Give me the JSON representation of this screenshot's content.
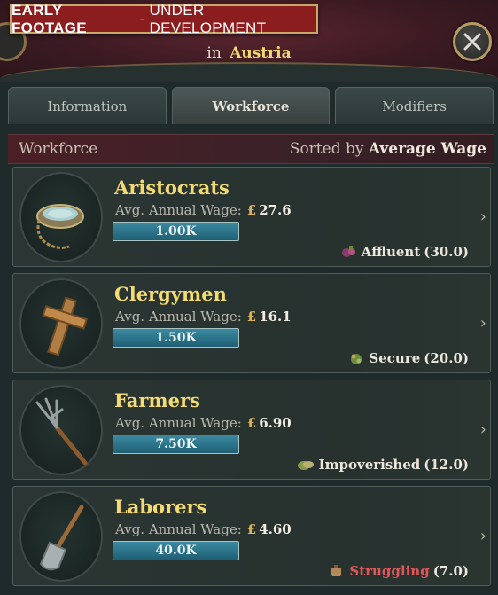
{
  "badge": {
    "strong": "EARLY FOOTAGE",
    "dash": "-",
    "rest": "UNDER DEVELOPMENT"
  },
  "location": {
    "prefix": "in",
    "country": "Austria"
  },
  "tabs": [
    {
      "label": "Information"
    },
    {
      "label": "Workforce"
    },
    {
      "label": "Modifiers"
    }
  ],
  "section": {
    "title": "Workforce",
    "sort_prefix": "Sorted by",
    "sort_key": "Average Wage"
  },
  "wage_label": "Avg. Annual Wage:",
  "currency_symbol": "£",
  "pops": [
    {
      "name": "Aristocrats",
      "wage": "27.6",
      "size": "1.00K",
      "status": "Affluent",
      "status_value": "(30.0)",
      "icon": "bowl-icon",
      "status_icon": "affluent-icon"
    },
    {
      "name": "Clergymen",
      "wage": "16.1",
      "size": "1.50K",
      "status": "Secure",
      "status_value": "(20.0)",
      "icon": "cross-icon",
      "status_icon": "secure-icon"
    },
    {
      "name": "Farmers",
      "wage": "6.90",
      "size": "7.50K",
      "status": "Impoverished",
      "status_value": "(12.0)",
      "icon": "pitchfork-icon",
      "status_icon": "impoverished-icon"
    },
    {
      "name": "Laborers",
      "wage": "4.60",
      "size": "40.0K",
      "status": "Struggling",
      "status_value": "(7.0)",
      "icon": "shovel-icon",
      "status_icon": "struggling-icon"
    }
  ],
  "colors": {
    "accent_gold": "#f3da72",
    "struggling_red": "#e0555a",
    "badge_red": "#8b1d1f"
  }
}
